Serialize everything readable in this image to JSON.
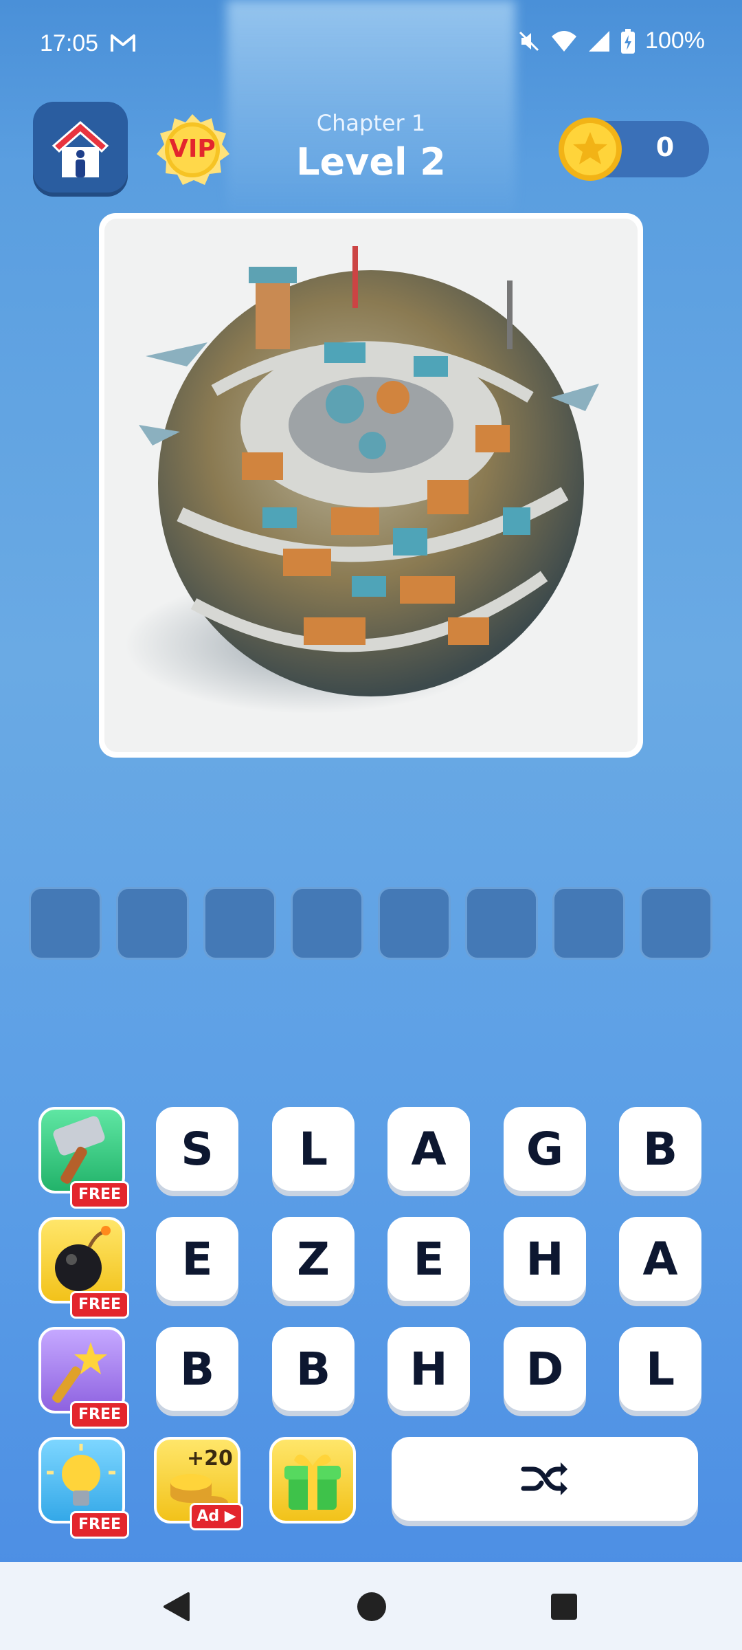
{
  "status_bar": {
    "time": "17:05",
    "battery": "100%",
    "icons": [
      "mail-icon",
      "mute-icon",
      "wifi-icon",
      "signal-icon",
      "battery-icon"
    ]
  },
  "header": {
    "chapter": "Chapter 1",
    "level": "Level 2",
    "vip_label": "VIP",
    "coins": "0"
  },
  "puzzle": {
    "image_icon": "planet-city-image",
    "answer_length": 8
  },
  "boosters": [
    {
      "name": "hammer",
      "tag": "FREE"
    },
    {
      "name": "bomb",
      "tag": "FREE"
    },
    {
      "name": "magic-wand",
      "tag": "FREE"
    },
    {
      "name": "lightbulb",
      "tag": "FREE"
    },
    {
      "name": "coins",
      "reward": "+20",
      "tag": "Ad"
    },
    {
      "name": "gift"
    }
  ],
  "letters": [
    [
      "S",
      "L",
      "A",
      "G",
      "B"
    ],
    [
      "E",
      "Z",
      "E",
      "H",
      "A"
    ],
    [
      "B",
      "B",
      "H",
      "D",
      "L"
    ]
  ],
  "colors": {
    "background": "#5b9ee6",
    "slot": "#4479b6",
    "free_tag": "#e3262d",
    "tile_text": "#0d1730"
  },
  "nav": [
    "back-icon",
    "home-icon",
    "recents-icon"
  ]
}
